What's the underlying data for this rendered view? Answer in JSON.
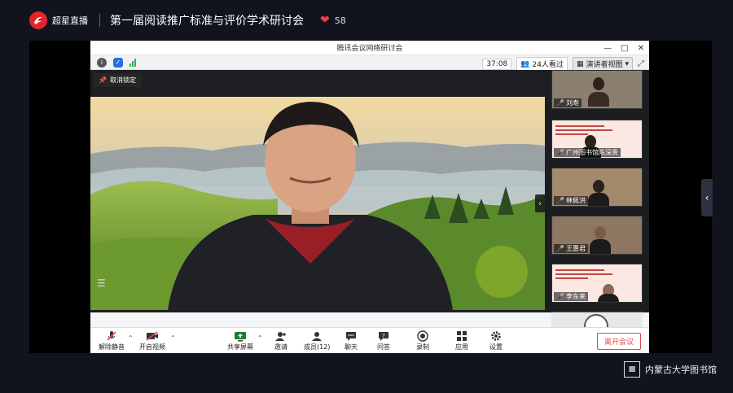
{
  "header": {
    "brand": "超星直播",
    "title": "第一届阅读推广标准与评价学术研讨会",
    "like_count": "58"
  },
  "meeting": {
    "window_title": "腾讯会议网络研讨会",
    "timer": "37:08",
    "viewers": "24人看过",
    "view_mode": "演讲者视图",
    "unpin_label": "取消锁定",
    "participants": [
      {
        "name": "刘寿"
      },
      {
        "name": "广州图书馆陈深贵"
      },
      {
        "name": "林佩洪"
      },
      {
        "name": "王惠君"
      },
      {
        "name": "李东来"
      }
    ],
    "toolbar": {
      "unmute": "解除静音",
      "start_video": "开启视频",
      "share_screen": "共享屏幕",
      "invite": "邀请",
      "members": "成员(12)",
      "chat": "聊天",
      "qa": "问答",
      "record": "录制",
      "apps": "应用",
      "settings": "设置",
      "leave": "离开会议"
    }
  },
  "watermark": "内蒙古大学图书馆",
  "colors": {
    "accent_red": "#e1252b",
    "heart": "#ee3d4a",
    "leave": "#e24a4a"
  }
}
